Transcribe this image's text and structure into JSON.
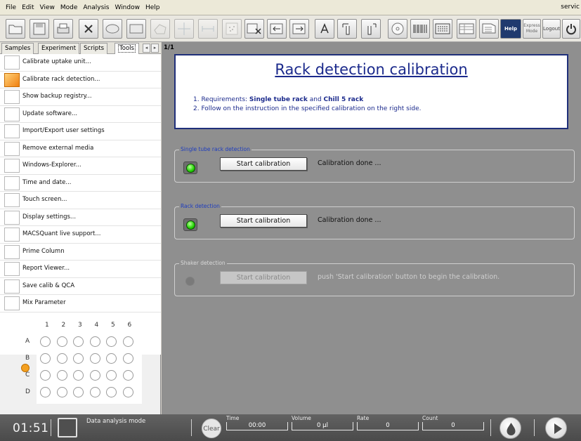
{
  "menu": {
    "items": [
      "File",
      "Edit",
      "View",
      "Mode",
      "Analysis",
      "Window",
      "Help"
    ],
    "user_partial": "servic"
  },
  "toolbar": {
    "help_label": "Help",
    "express_mode_label": "Express Mode",
    "logout_label": "Logout"
  },
  "tabs": {
    "items": [
      "Samples",
      "Experiment",
      "Scripts",
      "Tools"
    ],
    "active": "Tools"
  },
  "tools": [
    "Calibrate uptake unit...",
    "Calibrate rack detection...",
    "Show backup registry...",
    "Update software...",
    "Import/Export user settings",
    "Remove external media",
    "Windows-Explorer...",
    "Time and date...",
    "Touch screen...",
    "Display settings...",
    "MACSQuant live support...",
    "Prime Column",
    "Report Viewer...",
    "Save calib & QCA",
    "Mix Parameter"
  ],
  "selected_tool_index": 1,
  "plate": {
    "columns": [
      "1",
      "2",
      "3",
      "4",
      "5",
      "6"
    ],
    "rows": [
      "A",
      "B",
      "C",
      "D"
    ]
  },
  "main": {
    "page_indicator": "1/1",
    "title": "Rack detection calibration",
    "instruction1_prefix": "1. Requirements: ",
    "instruction1_bold1": "Single tube rack",
    "instruction1_mid": " and ",
    "instruction1_bold2": "Chill 5 rack",
    "instruction2": "2. Follow on the instruction in the specified calibration on the right side.",
    "groups": [
      {
        "label": "Single tube rack detection",
        "button": "Start calibration",
        "status": "Calibration done ...",
        "enabled": true
      },
      {
        "label": "Rack detection",
        "button": "Start calibration",
        "status": "Calibration done ...",
        "enabled": true
      },
      {
        "label": "Shaker detection",
        "button": "Start calibration",
        "status": "push 'Start calibration' button to begin the calibration.",
        "enabled": false
      }
    ]
  },
  "statusbar": {
    "time": "01:51",
    "mode": "Data analysis mode",
    "clear_label": "Clear",
    "fields": [
      {
        "label": "Time",
        "value": "00:00"
      },
      {
        "label": "Volume",
        "value": "0 µl"
      },
      {
        "label": "Rate",
        "value": "0"
      },
      {
        "label": "Count",
        "value": "0"
      }
    ]
  },
  "colors": {
    "title_blue": "#1b2a8c",
    "main_bg": "#8f8f8f",
    "led_green": "#20d000",
    "status_bg": "#555555",
    "selected_orange": "#f08010"
  }
}
